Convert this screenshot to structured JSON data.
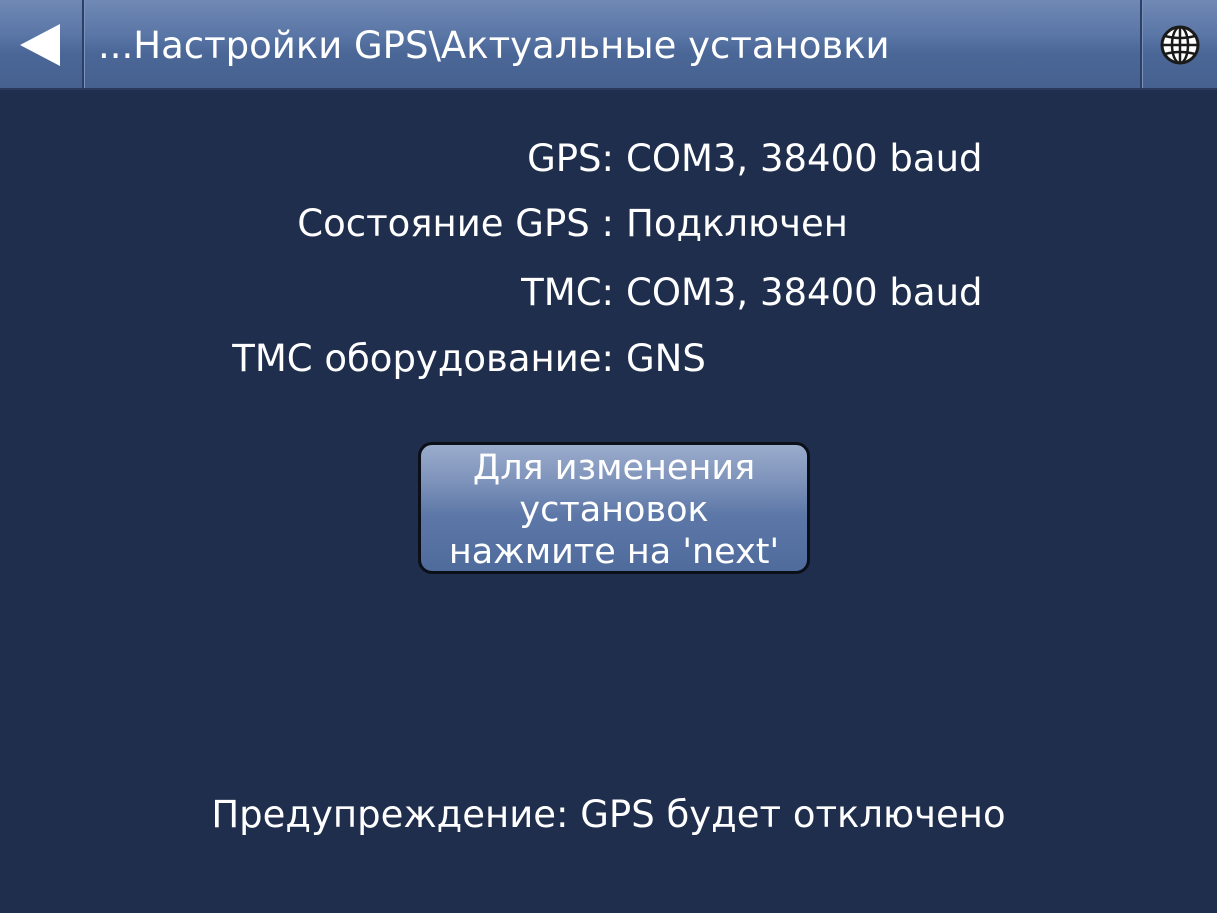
{
  "header": {
    "title": "...Настройки GPS\\Актуальные установки",
    "back_icon": "back-arrow-icon",
    "language_icon": "globe-icon"
  },
  "info": [
    {
      "label": "GPS:",
      "value": "COM3, 38400 baud"
    },
    {
      "label": "Состояние GPS :",
      "value": "Подключен"
    },
    {
      "label": "TMC:",
      "value": "COM3, 38400 baud"
    },
    {
      "label": "TMC оборудование:",
      "value": "GNS"
    }
  ],
  "change_button": {
    "label": "Для изменения\nустановок\nнажмите на 'next'"
  },
  "warning": "Предупреждение: GPS будет отключено",
  "colors": {
    "background": "#1f2e4d",
    "titlebar": "#5a76a6",
    "text": "#ffffff"
  }
}
